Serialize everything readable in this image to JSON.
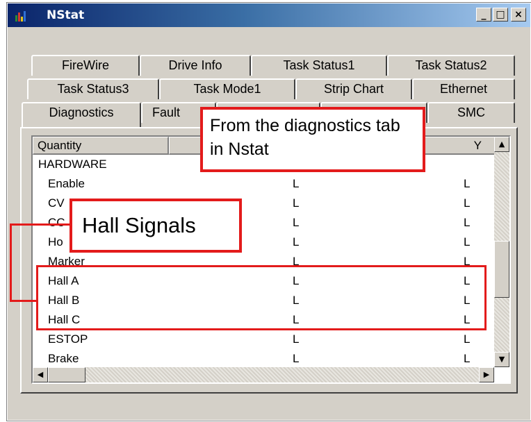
{
  "window": {
    "title": "NStat",
    "controls": [
      "_",
      "□",
      "×"
    ]
  },
  "tabs": {
    "row1": [
      "FireWire",
      "Drive Info",
      "Task Status1",
      "Task Status2"
    ],
    "row2": [
      "Task Status3",
      "Task Mode1",
      "Strip Chart",
      "Ethernet"
    ],
    "row3": [
      "Diagnostics",
      "Fault",
      "",
      "",
      "SMC"
    ],
    "active": "Diagnostics"
  },
  "list": {
    "columns": [
      "Quantity",
      "",
      "Y"
    ],
    "section": "HARDWARE",
    "rows": [
      {
        "q": "Enable",
        "x": "L",
        "y": "L"
      },
      {
        "q": "CV",
        "x": "L",
        "y": "L"
      },
      {
        "q": "CC",
        "x": "L",
        "y": "L"
      },
      {
        "q": "Ho",
        "x": "L",
        "y": "L"
      },
      {
        "q": "Marker",
        "x": "L",
        "y": "L"
      },
      {
        "q": "Hall A",
        "x": "L",
        "y": "L"
      },
      {
        "q": "Hall B",
        "x": "L",
        "y": "L"
      },
      {
        "q": "Hall C",
        "x": "L",
        "y": "L"
      },
      {
        "q": "ESTOP",
        "x": "L",
        "y": "L"
      },
      {
        "q": "Brake",
        "x": "L",
        "y": "L"
      }
    ]
  },
  "annotations": {
    "diagnostics_callout": "From the diagnostics tab in Nstat",
    "hall_callout": "Hall Signals",
    "accent_color": "#e31b1b"
  }
}
